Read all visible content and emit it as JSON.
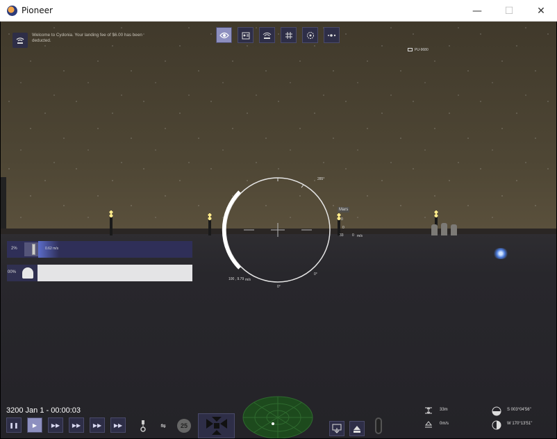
{
  "window": {
    "title": "Pioneer",
    "minimize": "—",
    "maximize": "☐",
    "close": "✕"
  },
  "notification": {
    "text": "Welcome to Cydonia. Your landing fee of $6.00 has been deducted."
  },
  "camera": {
    "label": "PU-9680"
  },
  "hud": {
    "target_label": "Mars",
    "heading_mark": "285°",
    "bottom_mark": "0°",
    "right_mark": "0°",
    "altitude_readout": "33",
    "velocity_readout": "0",
    "velocity_unit": "m/s",
    "speed_marker_1": "0",
    "speed_marker_2": "0",
    "gravity_readout": "100 , 9.79",
    "gravity_unit": "m/s"
  },
  "gauges": {
    "thrust": {
      "percent_label": "2%",
      "value_label": "0.62 m/s",
      "fill_fraction": 0.02
    },
    "fuel": {
      "percent_label": "00%",
      "fill_fraction": 1.0
    }
  },
  "time": {
    "date": "3200 Jan 1 - 00:00:03"
  },
  "speed_controls": [
    {
      "name": "pause-button",
      "glyph": "❚❚"
    },
    {
      "name": "play-button",
      "glyph": "▶"
    },
    {
      "name": "speed-2-button",
      "glyph": "▶▶"
    },
    {
      "name": "speed-3-button",
      "glyph": "▶▶"
    },
    {
      "name": "speed-4-button",
      "glyph": "▶▶"
    },
    {
      "name": "speed-5-button",
      "glyph": "▶▶"
    }
  ],
  "controls": {
    "hover_value": "25",
    "flight_mode_glyph": "⇋",
    "landing_glyph": "⊥"
  },
  "status": {
    "altitude": "33m",
    "speed": "0m/s",
    "latitude": "S 003°04'56\"",
    "longitude": "W 170°13'51\""
  },
  "colors": {
    "button_bg": "#2e2e47",
    "button_active": "#8d8fbf",
    "radar_green": "#1d4a1d"
  }
}
